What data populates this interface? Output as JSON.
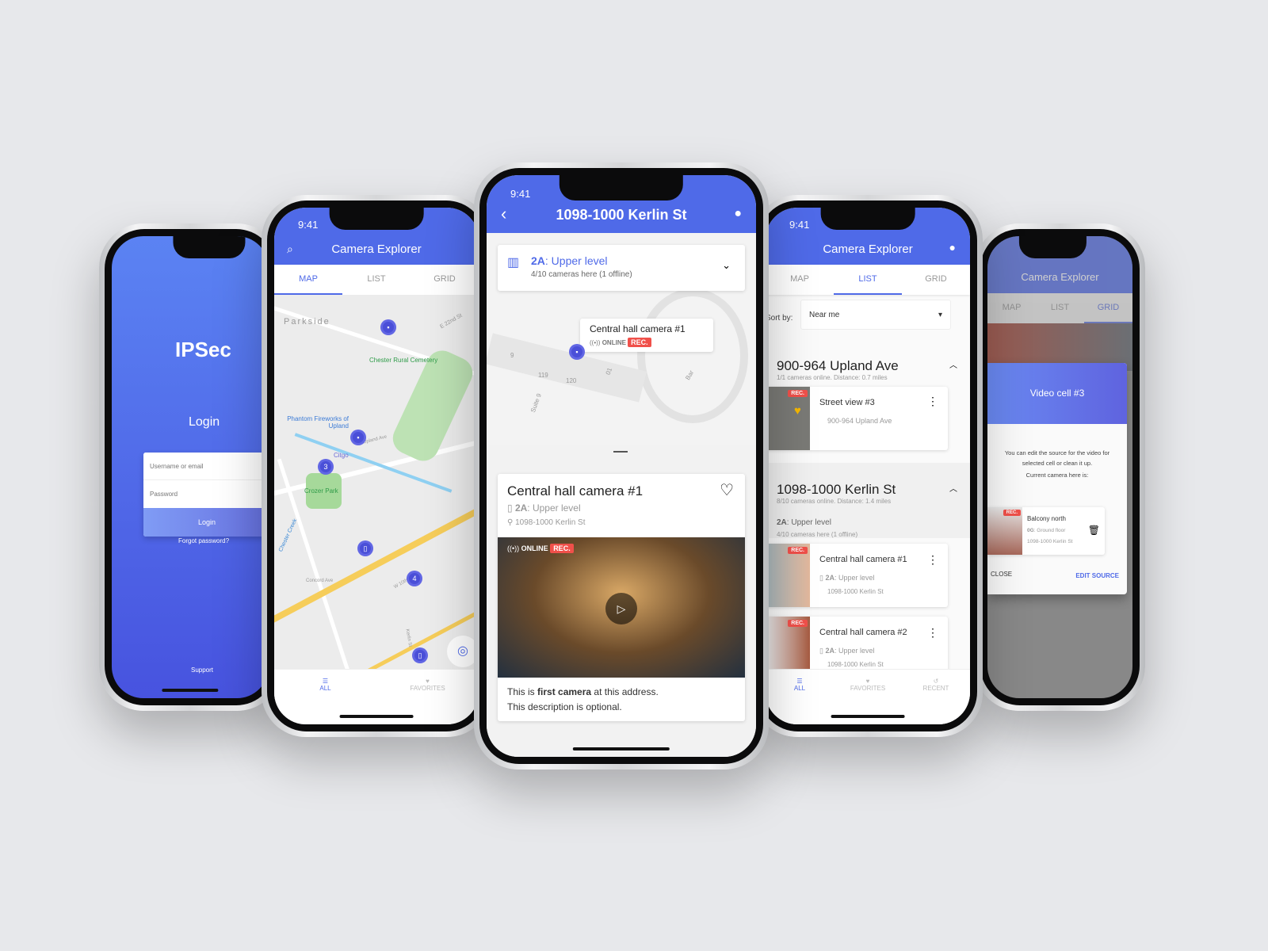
{
  "colors": {
    "background": "#e7e8eb",
    "brand_blue": "#4f6ae8",
    "rec_red": "#f0504a",
    "favorite_yellow": "#f5b800"
  },
  "status_time": "9:41",
  "login": {
    "logo": "IPSec",
    "title": "Login",
    "username_placeholder": "Username or email",
    "password_placeholder": "Password",
    "login_button": "Login",
    "forgot": "Forgot password?",
    "support": "Support"
  },
  "map_screen": {
    "title": "Camera Explorer",
    "tabs": [
      "MAP",
      "LIST",
      "GRID"
    ],
    "active_tab": "MAP",
    "labels": [
      "Parkside",
      "Chester Rural Cemetery",
      "Phantom Fireworks of Upland",
      "Citgo",
      "Crozer Park",
      "Upland Ave",
      "Concord Ave",
      "E 22nd St",
      "Chester Creek",
      "W 10th St",
      "Kerlin St"
    ],
    "clusters": [
      "3",
      "4"
    ],
    "nav": [
      "ALL",
      "FAVORITES"
    ]
  },
  "detail": {
    "title": "1098-1000 Kerlin St",
    "level_code": "2A",
    "level_name": ": Upper level",
    "level_sub": "4/10 cameras here (1 offline)",
    "popup_name": "Central hall camera #1",
    "online": "ONLINE",
    "rec": "REC.",
    "map_labels": [
      "9",
      "119",
      "120",
      "Suite 9",
      "Bar",
      "01"
    ],
    "camera_name": "Central hall camera #1",
    "camera_level_code": "2A",
    "camera_level": ": Upper level",
    "camera_address": "1098-1000 Kerlin St",
    "desc_pre": "This is ",
    "desc_bold": "first camera",
    "desc_post": " at this address.",
    "desc_line2": "This description is optional."
  },
  "list_screen": {
    "title": "Camera Explorer",
    "tabs": [
      "MAP",
      "LIST",
      "GRID"
    ],
    "active_tab": "LIST",
    "sort_label": "Sort by:",
    "sort_value": "Near me",
    "groups": [
      {
        "address": "900-964 Upland Ave",
        "sub": "1/1 cameras online. Distance: 0.7 miles",
        "cameras": [
          {
            "name": "Street view #3",
            "address": "900-964 Upland Ave",
            "rec": "REC."
          }
        ]
      },
      {
        "address": "1098-1000 Kerlin St",
        "sub": "8/10 cameras online. Distance: 1.4 miles",
        "level_code": "2A",
        "level_name": ": Upper level",
        "level_sub": "4/10 cameras here (1 offline)",
        "cameras": [
          {
            "name": "Central hall camera #1",
            "level_code": "2A",
            "level": ": Upper level",
            "address": "1098-1000 Kerlin St",
            "rec": "REC."
          },
          {
            "name": "Central hall camera #2",
            "level_code": "2A",
            "level": ": Upper level",
            "address": "1098-1000 Kerlin St",
            "rec": "REC."
          }
        ]
      }
    ],
    "nav": [
      "ALL",
      "FAVORITES",
      "RECENT"
    ]
  },
  "grid_screen": {
    "title": "Camera Explorer",
    "tabs": [
      "MAP",
      "LIST",
      "GRID"
    ],
    "active_tab": "GRID",
    "dialog": {
      "title": "Video cell #3",
      "text": "You can edit the source for the video for selected cell or clean it up.",
      "current": "Current camera here is:",
      "camera": {
        "name": "Balcony north",
        "level_code": "0G",
        "level": ": Ground floor",
        "address": "1098-1000 Kerlin St",
        "rec": "REC."
      },
      "close": "CLOSE",
      "edit": "EDIT SOURCE"
    }
  }
}
